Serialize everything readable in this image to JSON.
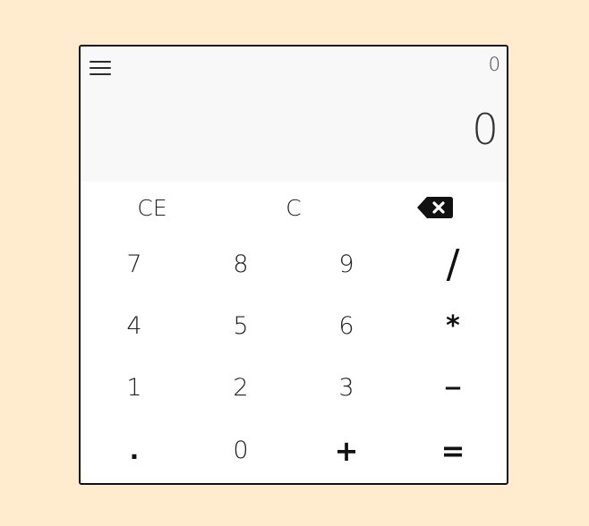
{
  "display": {
    "history": "0",
    "result": "0",
    "menu_icon": "hamburger-menu-icon"
  },
  "keys": {
    "row1": [
      "CE",
      "C"
    ],
    "backspace_icon": "backspace-icon",
    "row2": [
      "7",
      "8",
      "9",
      "/"
    ],
    "row3": [
      "4",
      "5",
      "6",
      "*"
    ],
    "row4": [
      "1",
      "2",
      "3",
      "−"
    ],
    "row5": [
      ".",
      "0",
      "+",
      "="
    ]
  },
  "colors": {
    "page_background": "#ffebcd",
    "display_background": "#f8f8f8",
    "keypad_background": "#ffffff"
  }
}
